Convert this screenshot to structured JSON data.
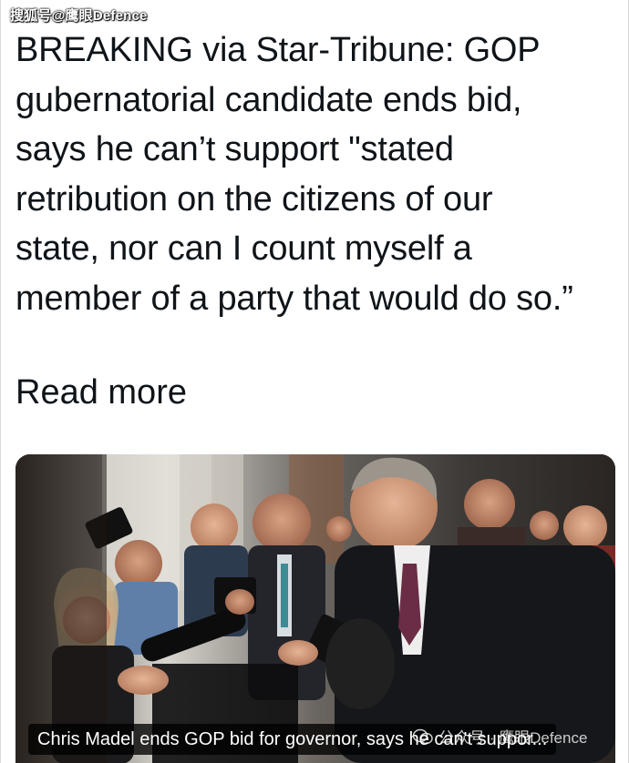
{
  "watermark": {
    "top_left": "搜狐号@鹰眼Defence"
  },
  "tweet": {
    "lines": [
      "BREAKING via Star-Tribune: GOP",
      "gubernatorial candidate ends bid,",
      "says he can’t support \"stated",
      "retribution on the citizens of our",
      "state, nor can I count myself a",
      "member of a party that would do so.”"
    ],
    "read_more": "Read more"
  },
  "link_card": {
    "caption": "Chris Madel ends GOP bid for governor, says he can't suppor...",
    "image_subject": "press-conference-photo"
  },
  "wechat_watermark": {
    "text": "公众号 · 鹰眼Defence",
    "icon": "wechat-icon"
  }
}
